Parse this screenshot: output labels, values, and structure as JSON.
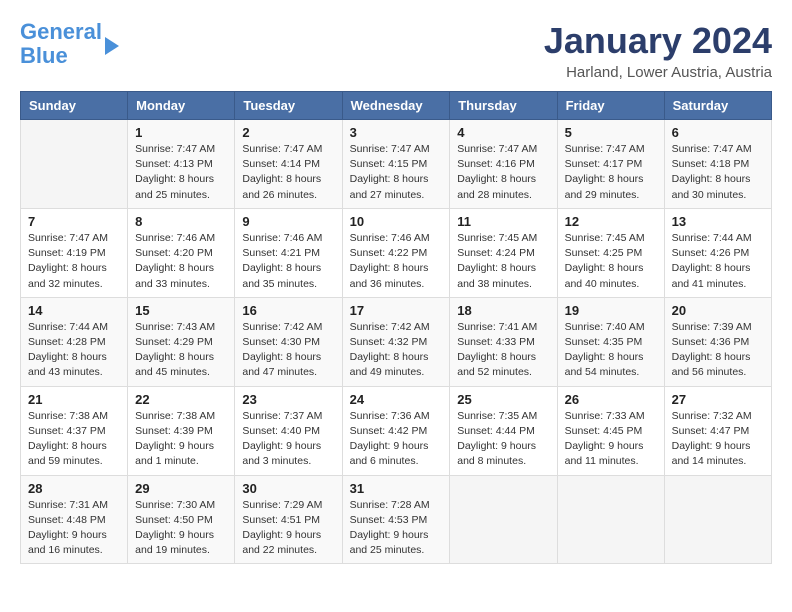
{
  "logo": {
    "line1": "General",
    "line2": "Blue"
  },
  "title": "January 2024",
  "location": "Harland, Lower Austria, Austria",
  "headers": [
    "Sunday",
    "Monday",
    "Tuesday",
    "Wednesday",
    "Thursday",
    "Friday",
    "Saturday"
  ],
  "weeks": [
    [
      {
        "num": "",
        "detail": ""
      },
      {
        "num": "1",
        "detail": "Sunrise: 7:47 AM\nSunset: 4:13 PM\nDaylight: 8 hours\nand 25 minutes."
      },
      {
        "num": "2",
        "detail": "Sunrise: 7:47 AM\nSunset: 4:14 PM\nDaylight: 8 hours\nand 26 minutes."
      },
      {
        "num": "3",
        "detail": "Sunrise: 7:47 AM\nSunset: 4:15 PM\nDaylight: 8 hours\nand 27 minutes."
      },
      {
        "num": "4",
        "detail": "Sunrise: 7:47 AM\nSunset: 4:16 PM\nDaylight: 8 hours\nand 28 minutes."
      },
      {
        "num": "5",
        "detail": "Sunrise: 7:47 AM\nSunset: 4:17 PM\nDaylight: 8 hours\nand 29 minutes."
      },
      {
        "num": "6",
        "detail": "Sunrise: 7:47 AM\nSunset: 4:18 PM\nDaylight: 8 hours\nand 30 minutes."
      }
    ],
    [
      {
        "num": "7",
        "detail": "Sunrise: 7:47 AM\nSunset: 4:19 PM\nDaylight: 8 hours\nand 32 minutes."
      },
      {
        "num": "8",
        "detail": "Sunrise: 7:46 AM\nSunset: 4:20 PM\nDaylight: 8 hours\nand 33 minutes."
      },
      {
        "num": "9",
        "detail": "Sunrise: 7:46 AM\nSunset: 4:21 PM\nDaylight: 8 hours\nand 35 minutes."
      },
      {
        "num": "10",
        "detail": "Sunrise: 7:46 AM\nSunset: 4:22 PM\nDaylight: 8 hours\nand 36 minutes."
      },
      {
        "num": "11",
        "detail": "Sunrise: 7:45 AM\nSunset: 4:24 PM\nDaylight: 8 hours\nand 38 minutes."
      },
      {
        "num": "12",
        "detail": "Sunrise: 7:45 AM\nSunset: 4:25 PM\nDaylight: 8 hours\nand 40 minutes."
      },
      {
        "num": "13",
        "detail": "Sunrise: 7:44 AM\nSunset: 4:26 PM\nDaylight: 8 hours\nand 41 minutes."
      }
    ],
    [
      {
        "num": "14",
        "detail": "Sunrise: 7:44 AM\nSunset: 4:28 PM\nDaylight: 8 hours\nand 43 minutes."
      },
      {
        "num": "15",
        "detail": "Sunrise: 7:43 AM\nSunset: 4:29 PM\nDaylight: 8 hours\nand 45 minutes."
      },
      {
        "num": "16",
        "detail": "Sunrise: 7:42 AM\nSunset: 4:30 PM\nDaylight: 8 hours\nand 47 minutes."
      },
      {
        "num": "17",
        "detail": "Sunrise: 7:42 AM\nSunset: 4:32 PM\nDaylight: 8 hours\nand 49 minutes."
      },
      {
        "num": "18",
        "detail": "Sunrise: 7:41 AM\nSunset: 4:33 PM\nDaylight: 8 hours\nand 52 minutes."
      },
      {
        "num": "19",
        "detail": "Sunrise: 7:40 AM\nSunset: 4:35 PM\nDaylight: 8 hours\nand 54 minutes."
      },
      {
        "num": "20",
        "detail": "Sunrise: 7:39 AM\nSunset: 4:36 PM\nDaylight: 8 hours\nand 56 minutes."
      }
    ],
    [
      {
        "num": "21",
        "detail": "Sunrise: 7:38 AM\nSunset: 4:37 PM\nDaylight: 8 hours\nand 59 minutes."
      },
      {
        "num": "22",
        "detail": "Sunrise: 7:38 AM\nSunset: 4:39 PM\nDaylight: 9 hours\nand 1 minute."
      },
      {
        "num": "23",
        "detail": "Sunrise: 7:37 AM\nSunset: 4:40 PM\nDaylight: 9 hours\nand 3 minutes."
      },
      {
        "num": "24",
        "detail": "Sunrise: 7:36 AM\nSunset: 4:42 PM\nDaylight: 9 hours\nand 6 minutes."
      },
      {
        "num": "25",
        "detail": "Sunrise: 7:35 AM\nSunset: 4:44 PM\nDaylight: 9 hours\nand 8 minutes."
      },
      {
        "num": "26",
        "detail": "Sunrise: 7:33 AM\nSunset: 4:45 PM\nDaylight: 9 hours\nand 11 minutes."
      },
      {
        "num": "27",
        "detail": "Sunrise: 7:32 AM\nSunset: 4:47 PM\nDaylight: 9 hours\nand 14 minutes."
      }
    ],
    [
      {
        "num": "28",
        "detail": "Sunrise: 7:31 AM\nSunset: 4:48 PM\nDaylight: 9 hours\nand 16 minutes."
      },
      {
        "num": "29",
        "detail": "Sunrise: 7:30 AM\nSunset: 4:50 PM\nDaylight: 9 hours\nand 19 minutes."
      },
      {
        "num": "30",
        "detail": "Sunrise: 7:29 AM\nSunset: 4:51 PM\nDaylight: 9 hours\nand 22 minutes."
      },
      {
        "num": "31",
        "detail": "Sunrise: 7:28 AM\nSunset: 4:53 PM\nDaylight: 9 hours\nand 25 minutes."
      },
      {
        "num": "",
        "detail": ""
      },
      {
        "num": "",
        "detail": ""
      },
      {
        "num": "",
        "detail": ""
      }
    ]
  ]
}
